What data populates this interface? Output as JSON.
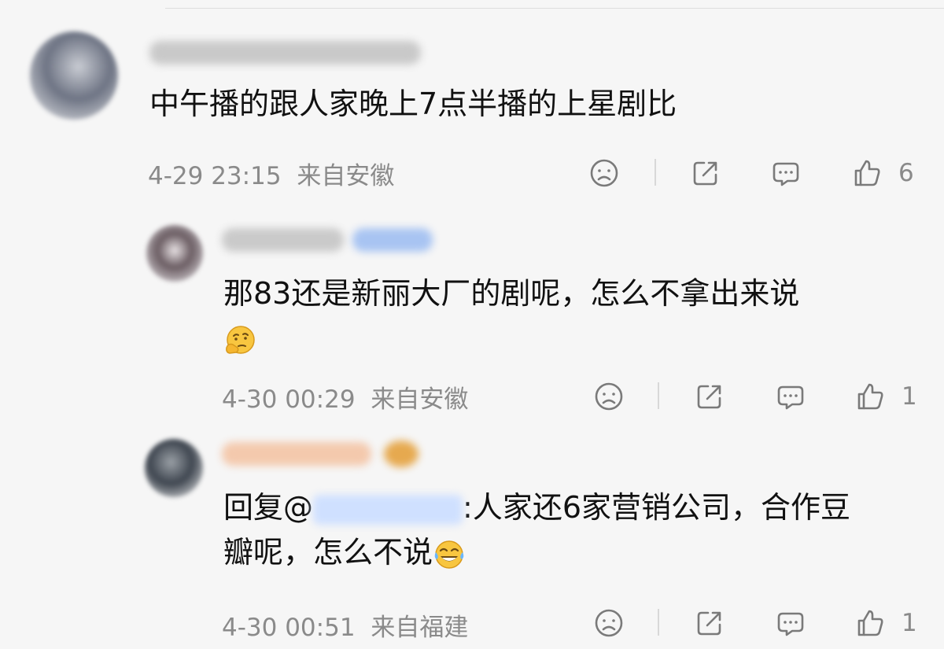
{
  "comments": [
    {
      "text": "中午播的跟人家晚上7点半播的上星剧比",
      "time": "4-29 23:15",
      "location": "来自安徽",
      "likes": "6"
    },
    {
      "text_line1": "那83还是新丽大厂的剧呢，怎么不拿出来说",
      "emoji": "thinking-emoji",
      "time": "4-30 00:29",
      "location": "来自安徽",
      "likes": "1"
    },
    {
      "prefix": "回复@",
      "text_rest": ":人家还6家营销公司，合作豆",
      "text_line2": "瓣呢，怎么不说",
      "emoji": "laughing-tears-emoji",
      "time": "4-30 00:51",
      "location": "来自福建",
      "likes": "1"
    }
  ],
  "colors": {
    "text": "#111111",
    "meta": "#8a8a8a",
    "mention": "#3a6ed6",
    "background": "#f6f6f6"
  }
}
